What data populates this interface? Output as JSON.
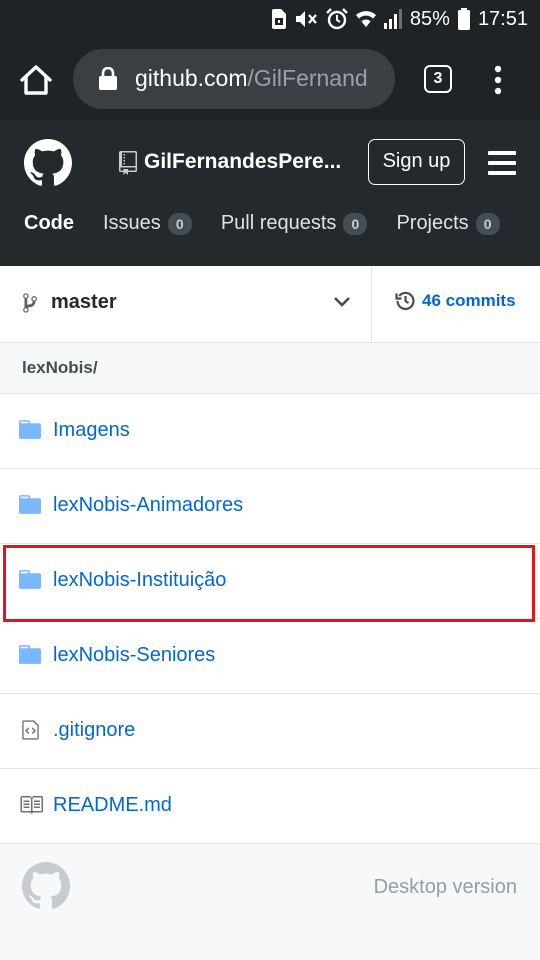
{
  "status_bar": {
    "battery_percent": "85%",
    "time": "17:51",
    "icons": [
      "sim-card-icon",
      "mute-icon",
      "alarm-icon",
      "wifi-icon",
      "signal-icon",
      "battery-icon"
    ]
  },
  "browser": {
    "url_domain": "github.com",
    "url_path": "/GilFernand",
    "tab_count": "3",
    "icons": [
      "home-icon",
      "lock-icon",
      "overflow-menu-icon"
    ]
  },
  "header": {
    "repo_name": "GilFernandesPere...",
    "signup_label": "Sign up",
    "nav": [
      {
        "label": "Code",
        "count": ""
      },
      {
        "label": "Issues",
        "count": "0"
      },
      {
        "label": "Pull requests",
        "count": "0"
      },
      {
        "label": "Projects",
        "count": "0"
      }
    ],
    "colors": {
      "bg": "#24292e",
      "counter_bg": "#444d56"
    }
  },
  "branch": {
    "name": "master",
    "commits_label": "46 commits"
  },
  "path": {
    "label": "lexNobis/"
  },
  "files": [
    {
      "name": "Imagens",
      "type": "folder"
    },
    {
      "name": "lexNobis-Animadores",
      "type": "folder"
    },
    {
      "name": "lexNobis-Instituição",
      "type": "folder"
    },
    {
      "name": "lexNobis-Seniores",
      "type": "folder"
    },
    {
      "name": ".gitignore",
      "type": "file"
    },
    {
      "name": "README.md",
      "type": "readme"
    }
  ],
  "footer": {
    "desktop_link": "Desktop version"
  },
  "colors": {
    "link": "#0366d6",
    "highlight": "#e3141c",
    "folder": "#79b8ff"
  }
}
